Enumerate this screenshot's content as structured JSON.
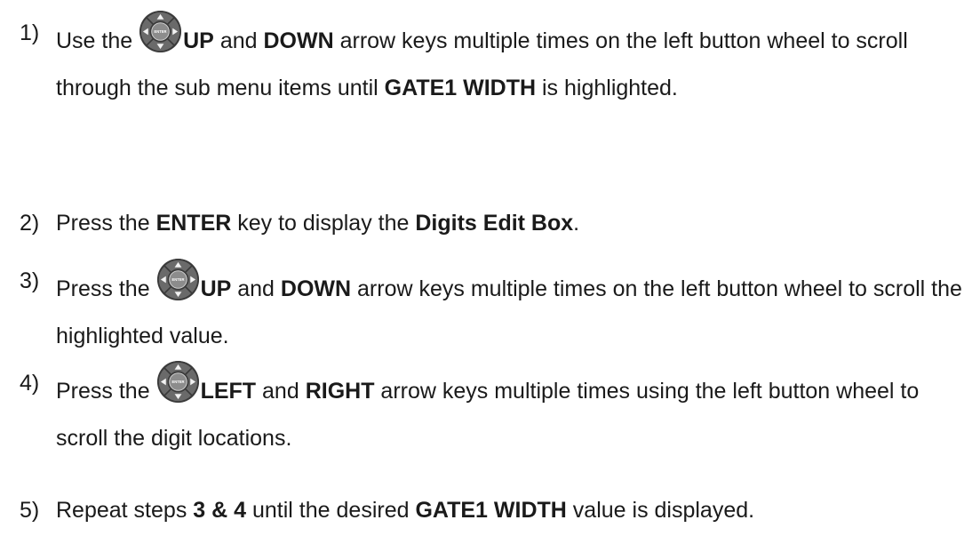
{
  "steps": [
    {
      "num": "1)",
      "lead": "Use the",
      "k1": "UP",
      "t1": "and",
      "k2": "DOWN",
      "t2": "arrow keys multiple times on the left button wheel to scroll through the sub menu items until",
      "k3": "GATE1 WIDTH",
      "t3": "is highlighted."
    },
    {
      "num": "2)",
      "t1": "Press the",
      "k1": "ENTER",
      "t2": "key to display the",
      "k2": "Digits Edit Box",
      "t3": "."
    },
    {
      "num": "3)",
      "lead": "Press the",
      "k1": "UP",
      "t1": "and",
      "k2": "DOWN",
      "t2": "arrow keys multiple times on the left button wheel to scroll the highlighted value."
    },
    {
      "num": "4)",
      "lead": "Press the",
      "k1": "LEFT",
      "t1": "and",
      "k2": "RIGHT",
      "t2": "arrow keys multiple times using the left button wheel to scroll the digit locations."
    },
    {
      "num": "5)",
      "t1": "Repeat steps",
      "k1": "3 & 4",
      "t2": "until the desired",
      "k2": "GATE1 WIDTH",
      "t3": "value is displayed."
    }
  ],
  "icons": {
    "wheel": "button-wheel-icon",
    "wheel_center_label": "ENTER",
    "wheel_color": "#3a3a3a"
  }
}
